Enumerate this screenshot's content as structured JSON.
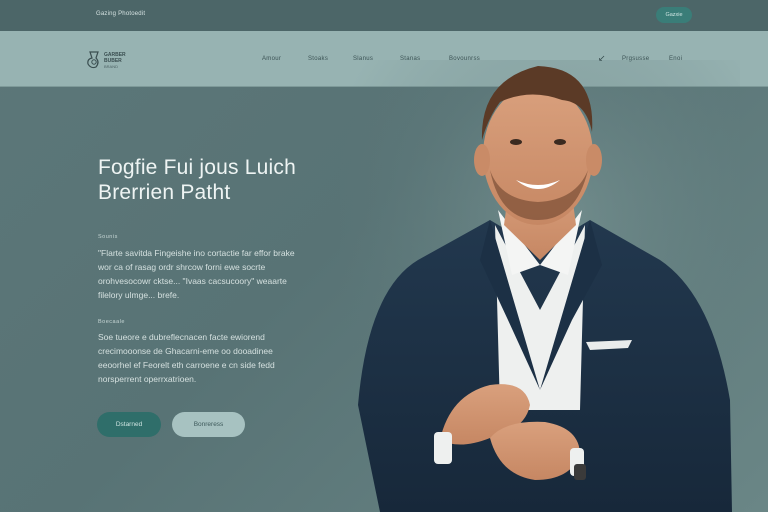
{
  "topbar": {
    "tagline": "Gazing Photoedit",
    "pill_label": "Gazxie"
  },
  "logo": {
    "name_line1": "GARBER",
    "name_line2": "BUBER",
    "sub": "BRAND"
  },
  "nav": {
    "items": [
      "Amour",
      "Stoaks",
      "Slanus",
      "Stanas",
      "Bovounrss"
    ],
    "right_items": [
      "Prgsusse",
      "Enoi"
    ]
  },
  "hero": {
    "title_line1": "Fogfie Fui jous Luich",
    "title_line2": "Brerrien  Patht",
    "section1_label": "Sounis",
    "section1_text": "\"Flarte savitda Fingeishe ino cortactie far effor brake wor ca of rasag ordr shrcow forni ewe socrte orohvesocowr cktse... \"Ivaas cacsucoory\" weaarte filelory ulmge... brefe.",
    "section2_label": "Boecaale",
    "section2_text": "Soe tueore e dubreflecnacen facte ewiorend crecimooonse de Ghacarni-eme oo dooadinee eeoorhel ef Feorelt eth carroene e cn side fedd norsperrent operrxatrioen.",
    "button_primary": "Dstarned",
    "button_secondary": "Bonreress"
  },
  "colors": {
    "background": "#5c7779",
    "topbar": "#4c6668",
    "navbar": "#97b3b2",
    "accent": "#2f6e6a",
    "secondary_button": "#a7c2c1"
  }
}
